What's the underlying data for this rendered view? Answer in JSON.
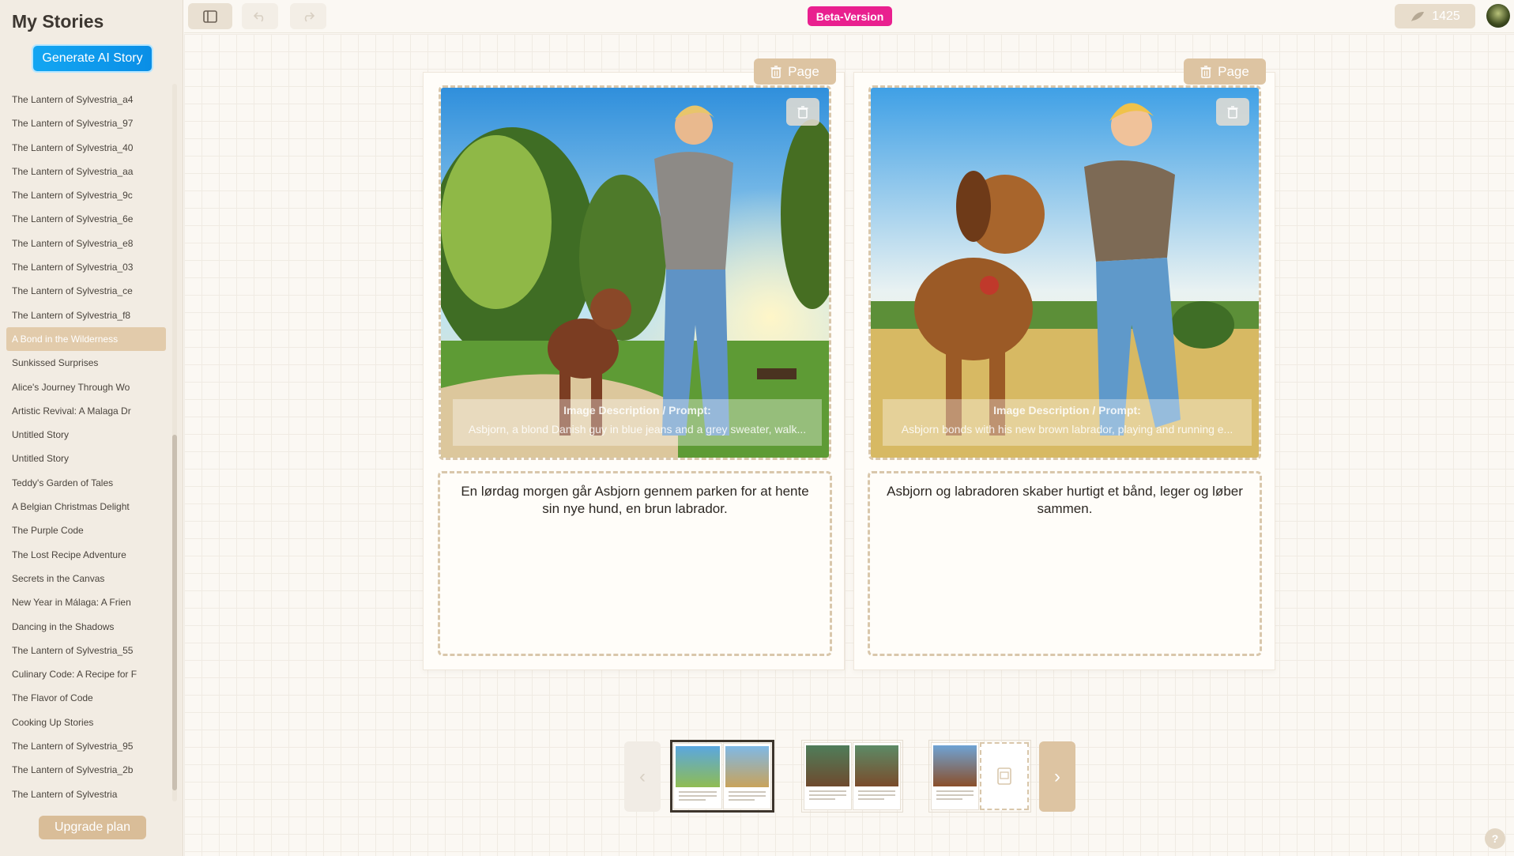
{
  "sidebar": {
    "title": "My Stories",
    "generate_label": "Generate AI Story",
    "upgrade_label": "Upgrade plan",
    "items": [
      "The Lantern of Sylvestria_a4",
      "The Lantern of Sylvestria_97",
      "The Lantern of Sylvestria_40",
      "The Lantern of Sylvestria_aa",
      "The Lantern of Sylvestria_9c",
      "The Lantern of Sylvestria_6e",
      "The Lantern of Sylvestria_e8",
      "The Lantern of Sylvestria_03",
      "The Lantern of Sylvestria_ce",
      "The Lantern of Sylvestria_f8",
      "A Bond in the Wilderness",
      "Sunkissed Surprises",
      "Alice's Journey Through Wo",
      "Artistic Revival: A Malaga Dr",
      "Untitled Story",
      "Untitled Story",
      "Teddy's Garden of Tales",
      "A Belgian Christmas Delight",
      "The Purple Code",
      "The Lost Recipe Adventure",
      "Secrets in the Canvas",
      "New Year in Málaga: A Frien",
      "Dancing in the Shadows",
      "The Lantern of Sylvestria_55",
      "Culinary Code: A Recipe for F",
      "The Flavor of Code",
      "Cooking Up Stories",
      "The Lantern of Sylvestria_95",
      "The Lantern of Sylvestria_2b",
      "The Lantern of Sylvestria"
    ],
    "active_index": 10
  },
  "topbar": {
    "beta_label": "Beta-Version",
    "credits": "1425"
  },
  "pages": [
    {
      "delete_label": "Page",
      "prompt_label": "Image Description / Prompt:",
      "prompt_text": "Asbjorn, a blond Danish guy in blue jeans and a grey sweater, walk...",
      "story_text": "En lørdag morgen går Asbjorn gennem parken for at hente sin nye hund, en brun labrador."
    },
    {
      "delete_label": "Page",
      "prompt_label": "Image Description / Prompt:",
      "prompt_text": "Asbjorn bonds with his new brown labrador, playing and running e...",
      "story_text": "Asbjorn og labradoren skaber hurtigt et bånd, leger og løber sammen."
    }
  ],
  "colors": {
    "accent": "#ddc4a2",
    "beta": "#e9208f",
    "generate": "#0a8ee6"
  },
  "icons": {
    "sidebar_toggle": "sidebar-toggle-icon",
    "undo": "undo-icon",
    "redo": "redo-icon",
    "trash": "trash-icon",
    "help": "help-icon"
  }
}
